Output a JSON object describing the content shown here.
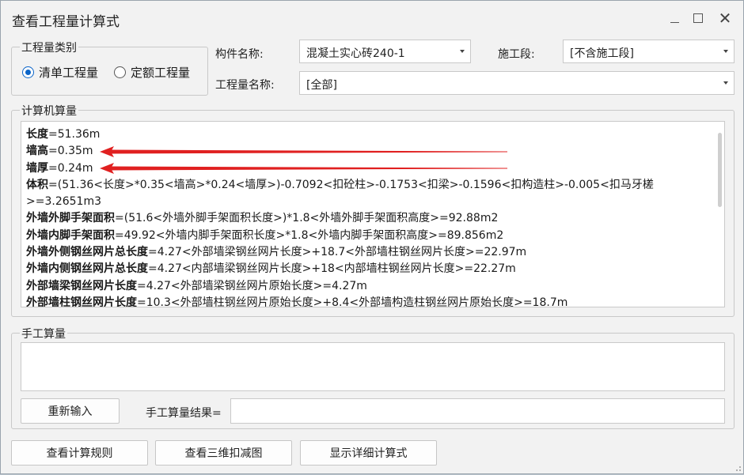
{
  "window": {
    "title": "查看工程量计算式"
  },
  "quantity_type": {
    "legend": "工程量类别",
    "options": [
      {
        "label": "清单工程量",
        "selected": true
      },
      {
        "label": "定额工程量",
        "selected": false
      }
    ]
  },
  "filters": {
    "component_label": "构件名称:",
    "component_value": "混凝土实心砖240-1",
    "stage_label": "施工段:",
    "stage_value": "[不含施工段]",
    "qty_name_label": "工程量名称:",
    "qty_name_value": "[全部]"
  },
  "computer_calc": {
    "legend": "计算机算量",
    "lines": [
      {
        "key": "长度",
        "rest": "=51.36m"
      },
      {
        "key": "墙高",
        "rest": "=0.35m"
      },
      {
        "key": "墙厚",
        "rest": "=0.24m"
      },
      {
        "key": "体积",
        "rest": "=(51.36<长度>*0.35<墙高>*0.24<墙厚>)-0.7092<扣砼柱>-0.1753<扣梁>-0.1596<扣构造柱>-0.005<扣马牙槎>=3.2651m3"
      },
      {
        "key": "外墙外脚手架面积",
        "rest": "=(51.6<外墙外脚手架面积长度>)*1.8<外墙外脚手架面积高度>=92.88m2"
      },
      {
        "key": "外墙内脚手架面积",
        "rest": "=49.92<外墙内脚手架面积长度>*1.8<外墙内脚手架面积高度>=89.856m2"
      },
      {
        "key": "外墙外侧钢丝网片总长度",
        "rest": "=4.27<外部墙梁钢丝网片长度>+18.7<外部墙柱钢丝网片长度>=22.97m"
      },
      {
        "key": "外墙内侧钢丝网片总长度",
        "rest": "=4.27<内部墙梁钢丝网片长度>+18<内部墙柱钢丝网片长度>=22.27m"
      },
      {
        "key": "外部墙梁钢丝网片长度",
        "rest": "=4.27<外部墙梁钢丝网片原始长度>=4.27m"
      },
      {
        "key": "外部墙柱钢丝网片长度",
        "rest": "=10.3<外部墙柱钢丝网片原始长度>+8.4<外部墙构造柱钢丝网片原始长度>=18.7m"
      }
    ],
    "arrow_color": "#e02020"
  },
  "manual_calc": {
    "legend": "手工算量",
    "reenter_button": "重新输入",
    "result_label": "手工算量结果="
  },
  "footer": {
    "view_rules": "查看计算规则",
    "view_3d": "查看三维扣减图",
    "show_detail": "显示详细计算式"
  }
}
